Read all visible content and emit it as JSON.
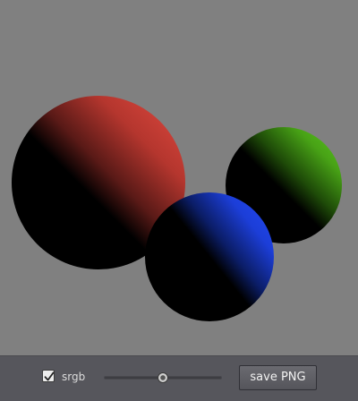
{
  "toolbar": {
    "srgb_label": "srgb",
    "srgb_checked": true,
    "exposure_slider_value": 0.5,
    "save_label": "save PNG"
  },
  "scene": {
    "background_color": "#808080",
    "spheres": [
      {
        "name": "red",
        "color": "#e0463c"
      },
      {
        "name": "green",
        "color": "#56c21c"
      },
      {
        "name": "blue",
        "color": "#1f45e6"
      }
    ]
  },
  "icons": {
    "checkbox": "checkmark-icon",
    "slider": "slider-thumb-icon"
  }
}
